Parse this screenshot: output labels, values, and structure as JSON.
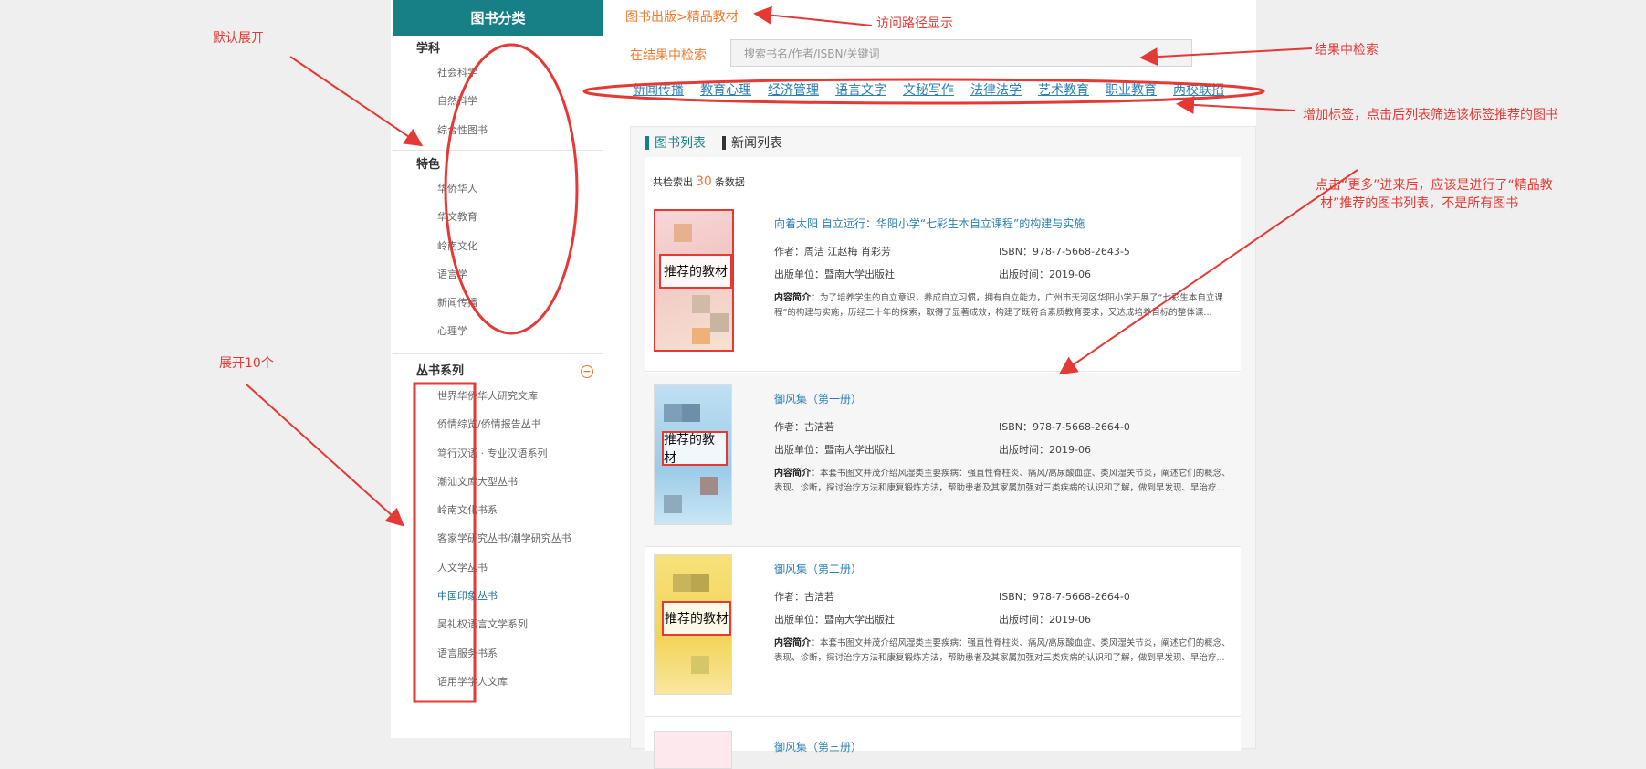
{
  "sidebar": {
    "header": "图书分类",
    "group1": {
      "title": "学科",
      "items": [
        "社会科学",
        "自然科学",
        "综合性图书"
      ]
    },
    "group2": {
      "title": "特色",
      "items": [
        "华侨华人",
        "华文教育",
        "岭南文化",
        "语言学",
        "新闻传播",
        "心理学"
      ]
    },
    "group3": {
      "title": "丛书系列",
      "items": [
        "世界华侨华人研究文库",
        "侨情综览/侨情报告丛书",
        "笃行汉语 · 专业汉语系列",
        "潮汕文库大型丛书",
        "岭南文化书系",
        "客家学研究丛书/潮学研究丛书",
        "人文学丛书",
        "中国印象丛书",
        "吴礼权语言文学系列",
        "语言服务书系",
        "语用学学人文库"
      ]
    }
  },
  "main": {
    "breadcrumb": "图书出版>精品教材",
    "search_label": "在结果中检索",
    "search_placeholder": "搜索书名/作者/ISBN/关键词",
    "tags": [
      "新闻传播",
      "教育心理",
      "经济管理",
      "语言文字",
      "文秘写作",
      "法律法学",
      "艺术教育",
      "职业教育",
      "两校联招"
    ],
    "tabs": [
      "图书列表",
      "新闻列表"
    ],
    "count_prefix": "共检索出",
    "count_value": "30",
    "count_suffix": "条数据",
    "books": [
      {
        "title": "向着太阳 自立远行：华阳小学“七彩生本自立课程”的构建与实施",
        "author_label": "作者：",
        "author": "周洁 江赵梅 肖彩芳",
        "isbn_label": "ISBN：",
        "isbn": "978-7-5668-2643-5",
        "publisher_label": "出版单位：",
        "publisher": "暨南大学出版社",
        "date_label": "出版时间：",
        "date": "2019-06",
        "desc_label": "内容简介：",
        "desc": "为了培养学生的自立意识，养成自立习惯，拥有自立能力，广州市天河区华阳小学开展了“七彩生本自立课程”的构建与实施，历经二十年的探索，取得了显著成效，构建了既符合素质教育要求，又达成培养目标的整体课...",
        "cover_tag": "推荐的教材"
      },
      {
        "title": "御风集（第一册）",
        "author_label": "作者：",
        "author": "古洁若",
        "isbn_label": "ISBN：",
        "isbn": "978-7-5668-2664-0",
        "publisher_label": "出版单位：",
        "publisher": "暨南大学出版社",
        "date_label": "出版时间：",
        "date": "2019-06",
        "desc_label": "内容简介：",
        "desc": "本套书图文并茂介绍风湿类主要疾病：强直性脊柱炎、痛风/高尿酸血症、类风湿关节炎，阐述它们的概念、表现、诊断，探讨治疗方法和康复锻炼方法，帮助患者及其家属加强对三类疾病的认识和了解，做到早发现、早治疗...",
        "cover_tag": "推荐的教材"
      },
      {
        "title": "御风集（第二册）",
        "author_label": "作者：",
        "author": "古洁若",
        "isbn_label": "ISBN：",
        "isbn": "978-7-5668-2664-0",
        "publisher_label": "出版单位：",
        "publisher": "暨南大学出版社",
        "date_label": "出版时间：",
        "date": "2019-06",
        "desc_label": "内容简介：",
        "desc": "本套书图文并茂介绍风湿类主要疾病：强直性脊柱炎、痛风/高尿酸血症、类风湿关节炎，阐述它们的概念、表现、诊断，探讨治疗方法和康复锻炼方法，帮助患者及其家属加强对三类疾病的认识和了解，做到早发现、早治疗...",
        "cover_tag": "推荐的教材"
      },
      {
        "title": "御风集（第三册）"
      }
    ]
  },
  "annotations": {
    "default_expand": "默认展开",
    "expand_ten": "展开10个",
    "path_display": "访问路径显示",
    "in_result_search": "结果中检索",
    "add_tags": "增加标签，点击后列表筛选该标签推荐的图书",
    "more_note_line1": "点击“更多”进来后，应该是进行了“精品教",
    "more_note_line2": "材”推荐的图书列表，不是所有图书"
  }
}
